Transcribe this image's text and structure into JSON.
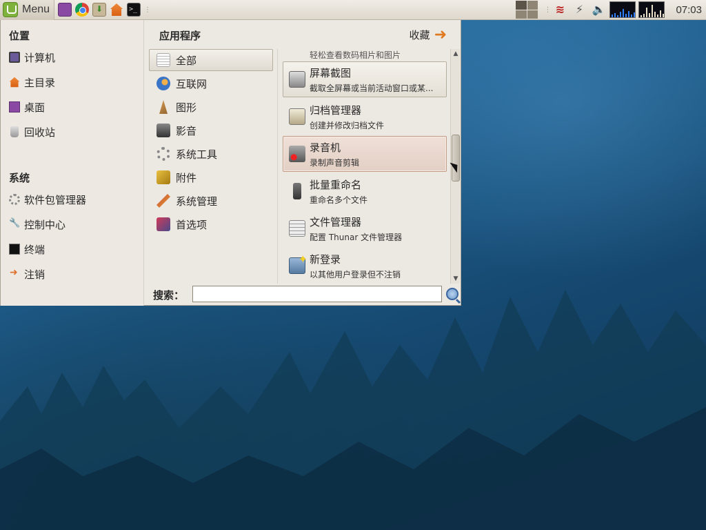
{
  "panel": {
    "menu_label": "Menu",
    "clock": "07:03",
    "launchers": [
      "desktop-icon",
      "chrome-icon",
      "download-icon",
      "home-folder-icon",
      "terminal-icon"
    ],
    "tray": [
      "workspace-switcher-icon",
      "network-icon",
      "usb-icon",
      "volume-icon",
      "cpu-monitor-icon",
      "memory-monitor-icon"
    ]
  },
  "places": {
    "title": "位置",
    "items": [
      {
        "label": "计算机",
        "icon": "computer-icon"
      },
      {
        "label": "主目录",
        "icon": "home-icon"
      },
      {
        "label": "桌面",
        "icon": "desktop-icon"
      },
      {
        "label": "回收站",
        "icon": "trash-icon"
      }
    ]
  },
  "system": {
    "title": "系统",
    "items": [
      {
        "label": "软件包管理器",
        "icon": "gear-icon"
      },
      {
        "label": "控制中心",
        "icon": "tools-icon"
      },
      {
        "label": "终端",
        "icon": "terminal-icon"
      },
      {
        "label": "注销",
        "icon": "logout-icon"
      }
    ]
  },
  "apps": {
    "title": "应用程序",
    "favorites_label": "收藏",
    "categories": [
      {
        "label": "全部",
        "icon": "document-icon",
        "active": true
      },
      {
        "label": "互联网",
        "icon": "globe-icon"
      },
      {
        "label": "图形",
        "icon": "graphics-icon"
      },
      {
        "label": "影音",
        "icon": "multimedia-icon"
      },
      {
        "label": "系统工具",
        "icon": "system-tools-icon"
      },
      {
        "label": "附件",
        "icon": "accessories-icon"
      },
      {
        "label": "系统管理",
        "icon": "administration-icon"
      },
      {
        "label": "首选项",
        "icon": "preferences-icon"
      }
    ],
    "items": [
      {
        "name": "",
        "desc": "轻松查看数码相片和图片",
        "icon": "image-viewer-icon"
      },
      {
        "name": "屏幕截图",
        "desc": "截取全屏幕或当前活动窗口或某...",
        "icon": "screenshot-icon"
      },
      {
        "name": "归档管理器",
        "desc": "创建并修改归档文件",
        "icon": "archive-icon"
      },
      {
        "name": "录音机",
        "desc": "录制声音剪辑",
        "icon": "microphone-icon"
      },
      {
        "name": "批量重命名",
        "desc": "重命名多个文件",
        "icon": "rename-icon"
      },
      {
        "name": "文件管理器",
        "desc": "配置 Thunar 文件管理器",
        "icon": "file-manager-icon"
      },
      {
        "name": "新登录",
        "desc": "以其他用户登录但不注销",
        "icon": "new-login-icon"
      }
    ]
  },
  "search": {
    "label": "搜索：",
    "value": "",
    "placeholder": ""
  },
  "colors": {
    "accent": "#e07a1f",
    "highlight": "#e3cfc4"
  }
}
